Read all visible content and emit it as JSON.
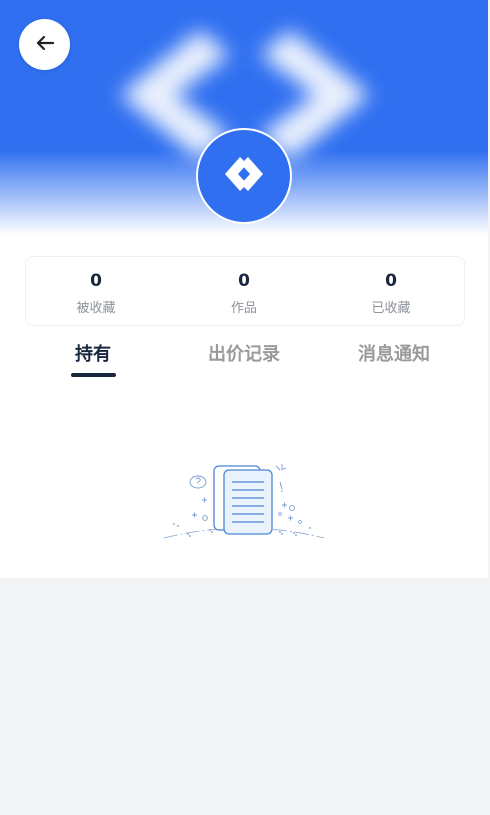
{
  "header": {
    "back_icon": "arrow-left-icon",
    "avatar_icon": "code-brackets-logo-icon"
  },
  "stats": [
    {
      "value": "0",
      "label": "被收藏"
    },
    {
      "value": "0",
      "label": "作品"
    },
    {
      "value": "0",
      "label": "已收藏"
    }
  ],
  "tabs": [
    {
      "label": "持有",
      "active": true
    },
    {
      "label": "出价记录",
      "active": false
    },
    {
      "label": "消息通知",
      "active": false
    }
  ],
  "empty_state": {
    "icon": "empty-documents-icon"
  },
  "colors": {
    "primary": "#2f6ff0",
    "text_dark": "#1a2540",
    "text_muted": "#9a9a9a",
    "page_bg": "#f2f4f6"
  }
}
